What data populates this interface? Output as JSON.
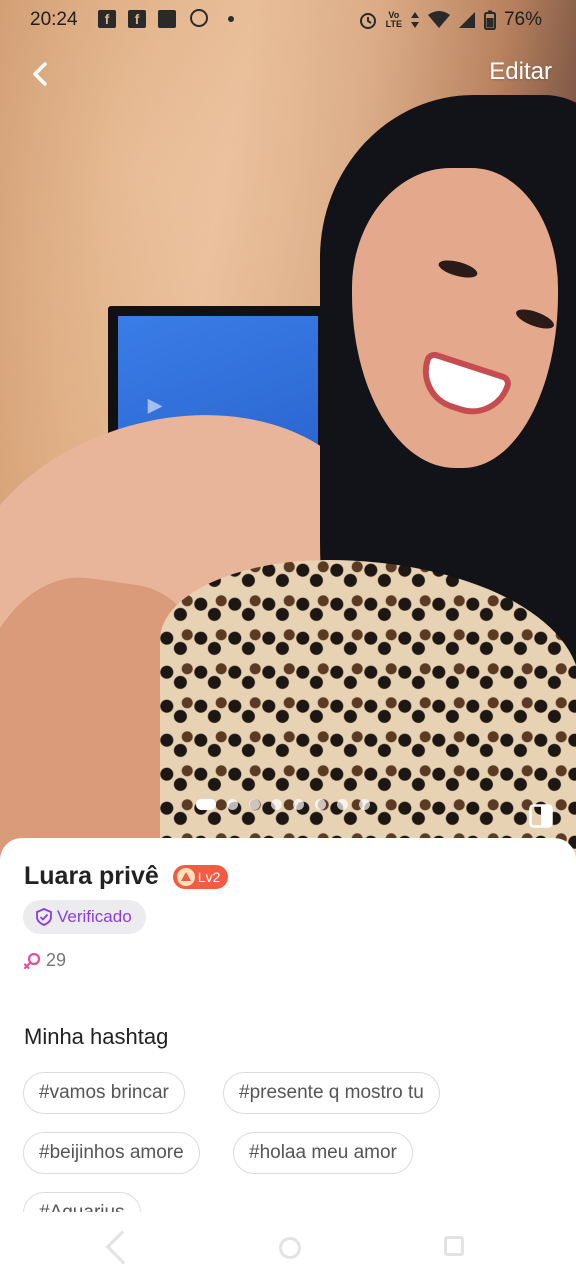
{
  "status_bar": {
    "time": "20:24",
    "network": "Vo LTE",
    "battery": "76%"
  },
  "header": {
    "back_icon": "chevron-left-icon",
    "edit_label": "Editar"
  },
  "photo_pager": {
    "total": 8,
    "active": 1
  },
  "profile": {
    "name": "Luara privê",
    "level": "Lv2",
    "verified_label": "Verificado",
    "followers_count": "29"
  },
  "hashtags": {
    "title": "Minha hashtag",
    "items": [
      "#vamos brincar",
      "#presente q mostro tu",
      "#beijinhos amore",
      "#holaa meu amor",
      "#Aquarius"
    ]
  },
  "colors": {
    "verified_purple": "#8a3ee0",
    "level_badge": "#f35b43",
    "accent_pink": "#e0509e"
  }
}
